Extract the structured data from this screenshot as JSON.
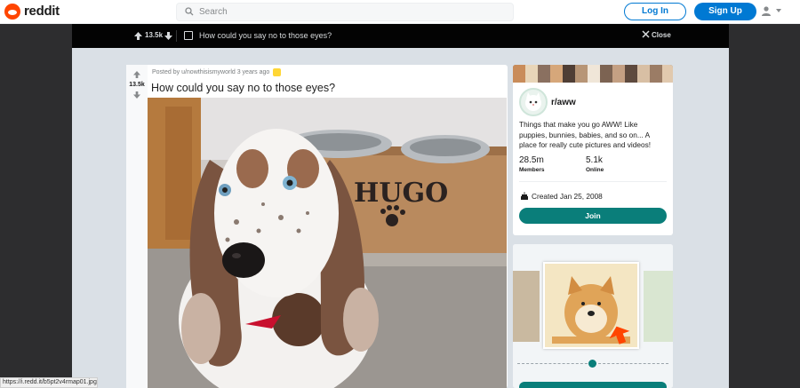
{
  "header": {
    "logo_text": "reddit",
    "search_placeholder": "Search",
    "login_label": "Log In",
    "signup_label": "Sign Up"
  },
  "postbar": {
    "score": "13.5k",
    "title": "How could you say no to those eyes?",
    "close_label": "Close"
  },
  "post": {
    "score": "13.5k",
    "meta": "Posted by u/nowthisismyworld 3 years ago",
    "title": "How could you say no to those eyes?",
    "bowl_text": "HUGO"
  },
  "sidebar": {
    "subreddit": "r/aww",
    "description": "Things that make you go AWW! Like puppies, bunnies, babies, and so on... A place for really cute pictures and videos!",
    "members_value": "28.5m",
    "members_label": "Members",
    "online_value": "5.1k",
    "online_label": "Online",
    "created": "Created Jan 25, 2008",
    "join_label": "Join"
  },
  "statusbar": {
    "url": "https://i.redd.it/b5pt2v4rmap01.jpg"
  },
  "colors": {
    "brand": "#ff4500",
    "primary": "#0079d3",
    "subreddit_accent": "#0a7e7a"
  }
}
